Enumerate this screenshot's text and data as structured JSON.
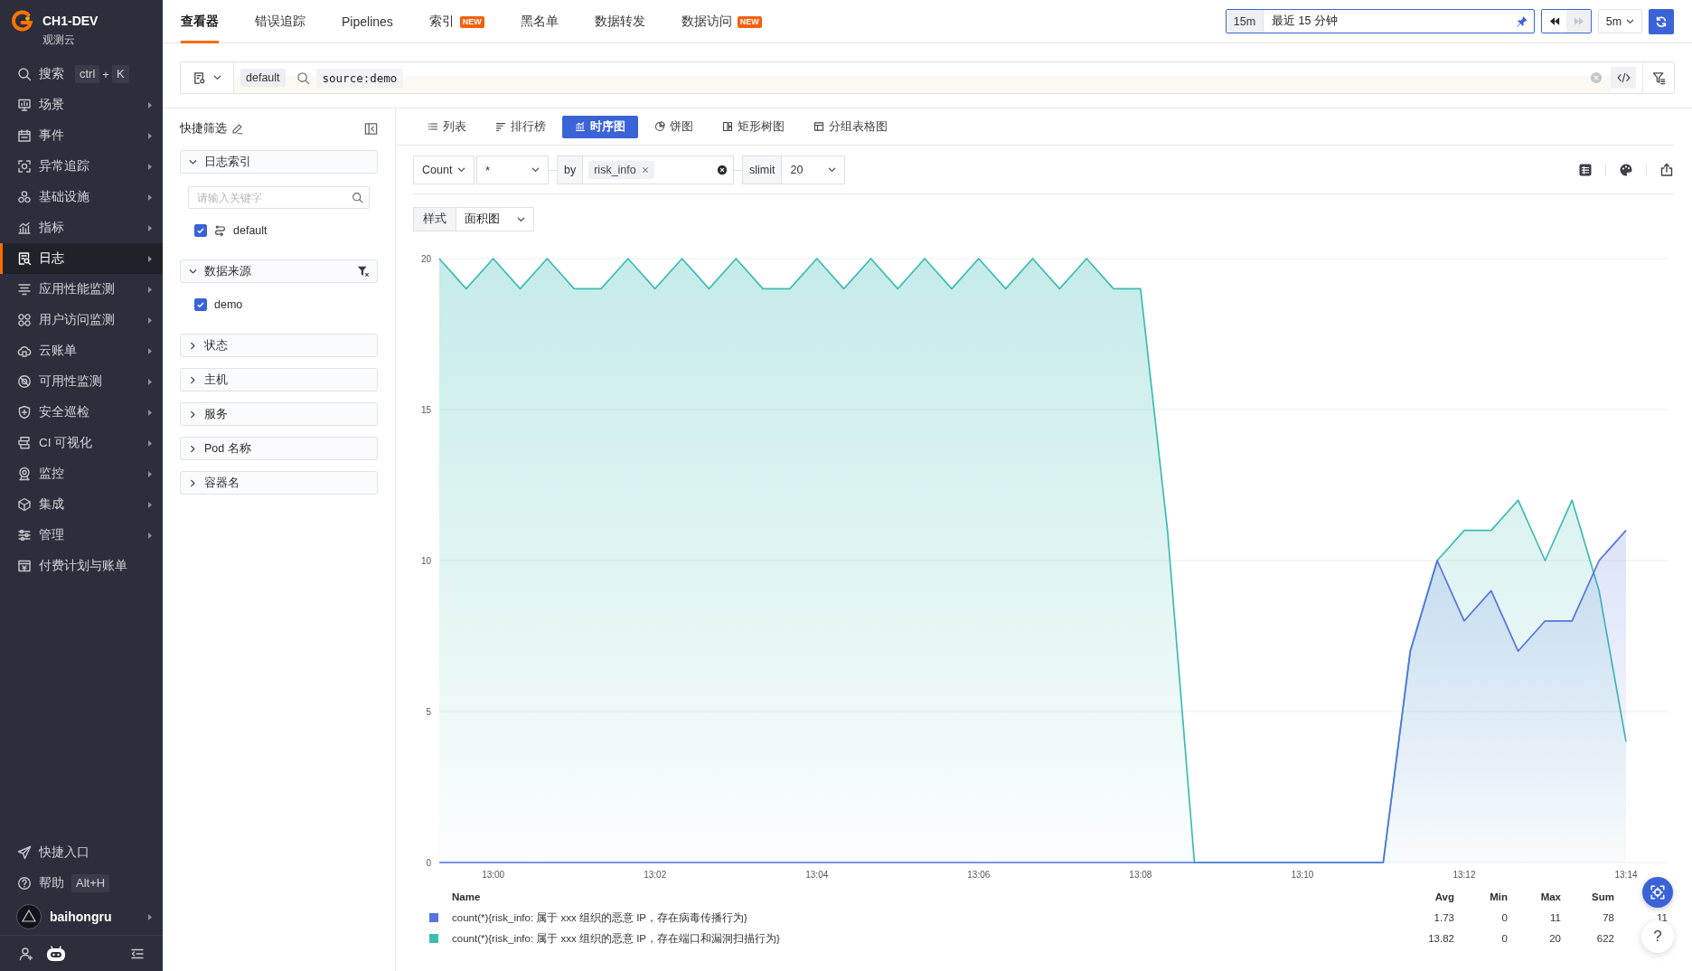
{
  "sidebar": {
    "workspace": {
      "name": "CH1-DEV",
      "subtitle": "观测云"
    },
    "search": {
      "label": "搜索",
      "keys": [
        "ctrl",
        "K"
      ],
      "key_joiner": "+"
    },
    "items": [
      {
        "label": "场景",
        "selected": false,
        "submenu": true
      },
      {
        "label": "事件",
        "selected": false,
        "submenu": true
      },
      {
        "label": "异常追踪",
        "selected": false,
        "submenu": true
      },
      {
        "label": "基础设施",
        "selected": false,
        "submenu": true
      },
      {
        "label": "指标",
        "selected": false,
        "submenu": true
      },
      {
        "label": "日志",
        "selected": true,
        "submenu": true
      },
      {
        "label": "应用性能监测",
        "selected": false,
        "submenu": true
      },
      {
        "label": "用户访问监测",
        "selected": false,
        "submenu": true
      },
      {
        "label": "云账单",
        "selected": false,
        "submenu": true
      },
      {
        "label": "可用性监测",
        "selected": false,
        "submenu": true
      },
      {
        "label": "安全巡检",
        "selected": false,
        "submenu": true
      },
      {
        "label": "CI 可视化",
        "selected": false,
        "submenu": true
      },
      {
        "label": "监控",
        "selected": false,
        "submenu": true
      },
      {
        "label": "集成",
        "selected": false,
        "submenu": true
      },
      {
        "label": "管理",
        "selected": false,
        "submenu": true
      },
      {
        "label": "付费计划与账单",
        "selected": false,
        "submenu": false
      }
    ],
    "footer": [
      {
        "label": "快捷入口"
      },
      {
        "label": "帮助",
        "shortcut": "Alt+H"
      }
    ],
    "user": {
      "name": "baihongru"
    }
  },
  "top_bar": {
    "tabs": [
      {
        "label": "查看器",
        "selected": true
      },
      {
        "label": "错误追踪",
        "selected": false
      },
      {
        "label": "Pipelines",
        "selected": false
      },
      {
        "label": "索引",
        "badge": "NEW",
        "selected": false
      },
      {
        "label": "黑名单",
        "selected": false
      },
      {
        "label": "数据转发",
        "selected": false
      },
      {
        "label": "数据访问",
        "badge": "NEW",
        "selected": false
      }
    ],
    "time_range": {
      "quick": "15m",
      "label": "最近 15 分钟"
    },
    "history": [
      {
        "kind": "back",
        "disabled": false
      },
      {
        "kind": "forward",
        "disabled": true
      }
    ],
    "refresh_interval": "5m"
  },
  "query_bar": {
    "index": "default",
    "query": "source:demo"
  },
  "filter_panel": {
    "title": "快捷筛选",
    "groups": [
      {
        "label": "日志索引",
        "expanded": true,
        "filtered": false,
        "search_placeholder": "请输入关键字",
        "options": [
          {
            "label": "default",
            "kind": "index",
            "checked": true
          }
        ]
      },
      {
        "label": "数据来源",
        "expanded": true,
        "filtered": true,
        "options": [
          {
            "label": "demo",
            "kind": "value",
            "checked": true
          }
        ]
      },
      {
        "label": "状态",
        "expanded": false,
        "filtered": false
      },
      {
        "label": "主机",
        "expanded": false,
        "filtered": false
      },
      {
        "label": "服务",
        "expanded": false,
        "filtered": false
      },
      {
        "label": "Pod 名称",
        "expanded": false,
        "filtered": false
      },
      {
        "label": "容器名",
        "expanded": false,
        "filtered": false
      }
    ]
  },
  "main": {
    "view_tabs": [
      {
        "label": "列表",
        "selected": false
      },
      {
        "label": "排行榜",
        "selected": false
      },
      {
        "label": "时序图",
        "selected": true
      },
      {
        "label": "饼图",
        "selected": false
      },
      {
        "label": "矩形树图",
        "selected": false
      },
      {
        "label": "分组表格图",
        "selected": false
      }
    ],
    "query_builder": {
      "aggregate": "Count",
      "field": "*",
      "by_label": "by",
      "by_tags": [
        "risk_info"
      ],
      "limit_label": "slimit",
      "limit": "20"
    },
    "style": {
      "label": "样式",
      "value": "面积图"
    },
    "chart": {
      "chart_data": {
        "type": "area",
        "grid": true,
        "categories": [
          null,
          null,
          "13:00",
          null,
          null,
          null,
          null,
          null,
          "13:02",
          null,
          null,
          null,
          null,
          null,
          "13:04",
          null,
          null,
          null,
          null,
          null,
          "13:06",
          null,
          null,
          null,
          null,
          null,
          "13:08",
          null,
          null,
          null,
          null,
          null,
          "13:10",
          null,
          null,
          null,
          null,
          null,
          "13:12",
          null,
          null,
          null,
          null,
          null,
          "13:14"
        ],
        "ylim": [
          0,
          20
        ],
        "yticks": [
          0,
          5,
          10,
          15,
          20
        ],
        "series": [
          {
            "name": "count(*){risk_info: 属于 xxx 组织的恶意 IP，存在病毒传播行为}",
            "color": "#5674e0",
            "values": [
              0,
              0,
              0,
              0,
              0,
              0,
              0,
              0,
              0,
              0,
              0,
              0,
              0,
              0,
              0,
              0,
              0,
              0,
              0,
              0,
              0,
              0,
              0,
              0,
              0,
              0,
              0,
              0,
              0,
              0,
              0,
              0,
              0,
              0,
              0,
              0,
              7,
              10,
              8,
              9,
              7,
              8,
              8,
              10,
              11
            ]
          },
          {
            "name": "count(*){risk_info: 属于 xxx 组织的恶意 IP，存在端口和漏洞扫描行为}",
            "color": "#3dbcb4",
            "values": [
              20,
              19,
              20,
              19,
              20,
              19,
              19,
              20,
              19,
              20,
              19,
              20,
              19,
              19,
              20,
              19,
              20,
              19,
              20,
              19,
              20,
              19,
              20,
              19,
              20,
              19,
              19,
              11,
              0,
              0,
              0,
              0,
              0,
              0,
              0,
              0,
              7,
              10,
              11,
              11,
              12,
              10,
              12,
              9,
              4
            ]
          }
        ]
      },
      "legend": {
        "columns": [
          "Name",
          "Avg",
          "Min",
          "Max",
          "Sum"
        ],
        "rows": [
          {
            "avg": "1.73",
            "min": "0",
            "max": "11",
            "sum": "78",
            "column_6": "11"
          },
          {
            "avg": "13.82",
            "min": "0",
            "max": "20",
            "sum": "622"
          }
        ]
      }
    }
  },
  "floating": {
    "help": "?"
  }
}
